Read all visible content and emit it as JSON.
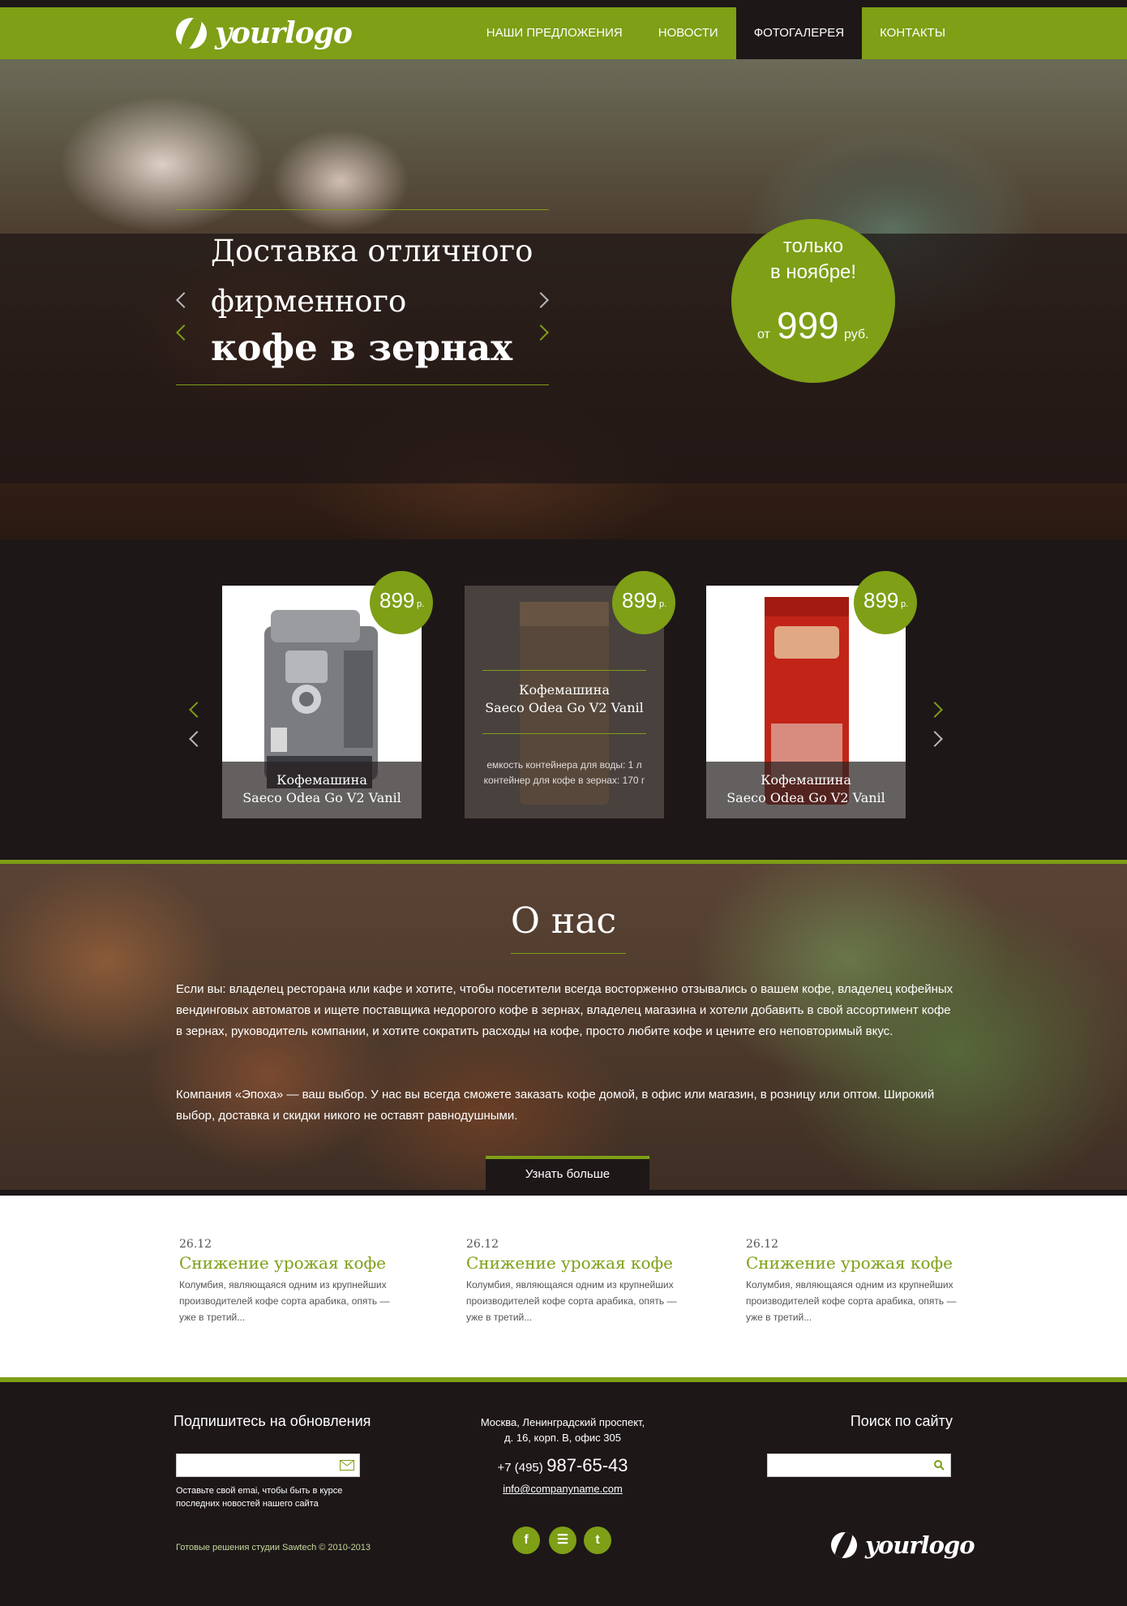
{
  "header": {
    "logo": "yourlogo",
    "nav": [
      {
        "label": "НАШИ ПРЕДЛОЖЕНИЯ"
      },
      {
        "label": "НОВОСТИ"
      },
      {
        "label": "ФОТОГАЛЕРЕЯ"
      },
      {
        "label": "КОНТАКТЫ"
      }
    ],
    "active_nav": "ФОТОГАЛЕРЕЯ"
  },
  "hero": {
    "title_line1": "Доставка отличного",
    "title_line2": "фирменного",
    "title_line3": "кофе в зернах",
    "promo": {
      "line1": "только",
      "line2": "в ноябре!",
      "from": "от",
      "price": "999",
      "currency": "руб."
    }
  },
  "products": [
    {
      "price": "899",
      "currency": "р.",
      "name_line1": "Кофемашина",
      "name_line2": "Saeco Odea Go V2 Vanil",
      "image": "coffee-machine"
    },
    {
      "price": "899",
      "currency": "р.",
      "name_line1": "Кофемашина",
      "name_line2": "Saeco Odea Go V2 Vanil",
      "spec1": "емкость контейнера для воды: 1 л",
      "spec2": "контейнер для кофе в зернах: 170 г",
      "image": "coffee-bag"
    },
    {
      "price": "899",
      "currency": "р.",
      "name_line1": "Кофемашина",
      "name_line2": "Saeco Odea Go V2 Vanil",
      "image": "coffee-bag-red"
    }
  ],
  "about": {
    "title": "О нас",
    "paragraph1": "Если вы: владелец ресторана или кафе и хотите, чтобы посетители всегда восторженно отзывались о вашем кофе, владелец кофейных вендинговых автоматов и ищете поставщика недорогого кофе в зернах, владелец магазина и хотели добавить в свой ассортимент кофе в зернах, руководитель компании, и хотите сократить расходы на кофе, просто любите кофе и цените его неповторимый вкус.",
    "paragraph2": "Компания «Эпоха» — ваш выбор. У нас вы всегда сможете заказать кофе домой, в офис или магазин, в розницу или оптом. Широкий выбор, доставка и скидки никого не оставят равнодушными.",
    "button": "Узнать больше"
  },
  "news": [
    {
      "date": "26.12",
      "title": "Снижение урожая кофе",
      "text": "Колумбия, являющаяся одним из крупнейших производителей кофе сорта арабика, опять — уже в третий..."
    },
    {
      "date": "26.12",
      "title": "Снижение урожая кофе",
      "text": "Колумбия, являющаяся одним из крупнейших производителей кофе сорта арабика, опять — уже в третий..."
    },
    {
      "date": "26.12",
      "title": "Снижение урожая кофе",
      "text": "Колумбия, являющаяся одним из крупнейших производителей кофе сорта арабика, опять — уже в третий..."
    }
  ],
  "footer": {
    "subscribe_title": "Подпишитесь на обновления",
    "subscribe_note": "Оставьте свой emai, чтобы быть в курсе последних новостей нашего сайта",
    "copyright": "Готовые решения студии Sawtech © 2010-2013",
    "address_line1": "Москва, Ленинградский проспект,",
    "address_line2": "д. 16, корп. В, офис 305",
    "phone_prefix": "+7 (495)",
    "phone_number": "987-65-43",
    "email": "info@companyname.com",
    "social": [
      {
        "icon": "facebook-icon",
        "glyph": "f"
      },
      {
        "icon": "rss-icon",
        "glyph": "☰"
      },
      {
        "icon": "twitter-icon",
        "glyph": "t"
      }
    ],
    "search_title": "Поиск по сайту",
    "logo": "yourlogo"
  },
  "colors": {
    "accent": "#7e9f16",
    "dark": "#1d1718"
  }
}
